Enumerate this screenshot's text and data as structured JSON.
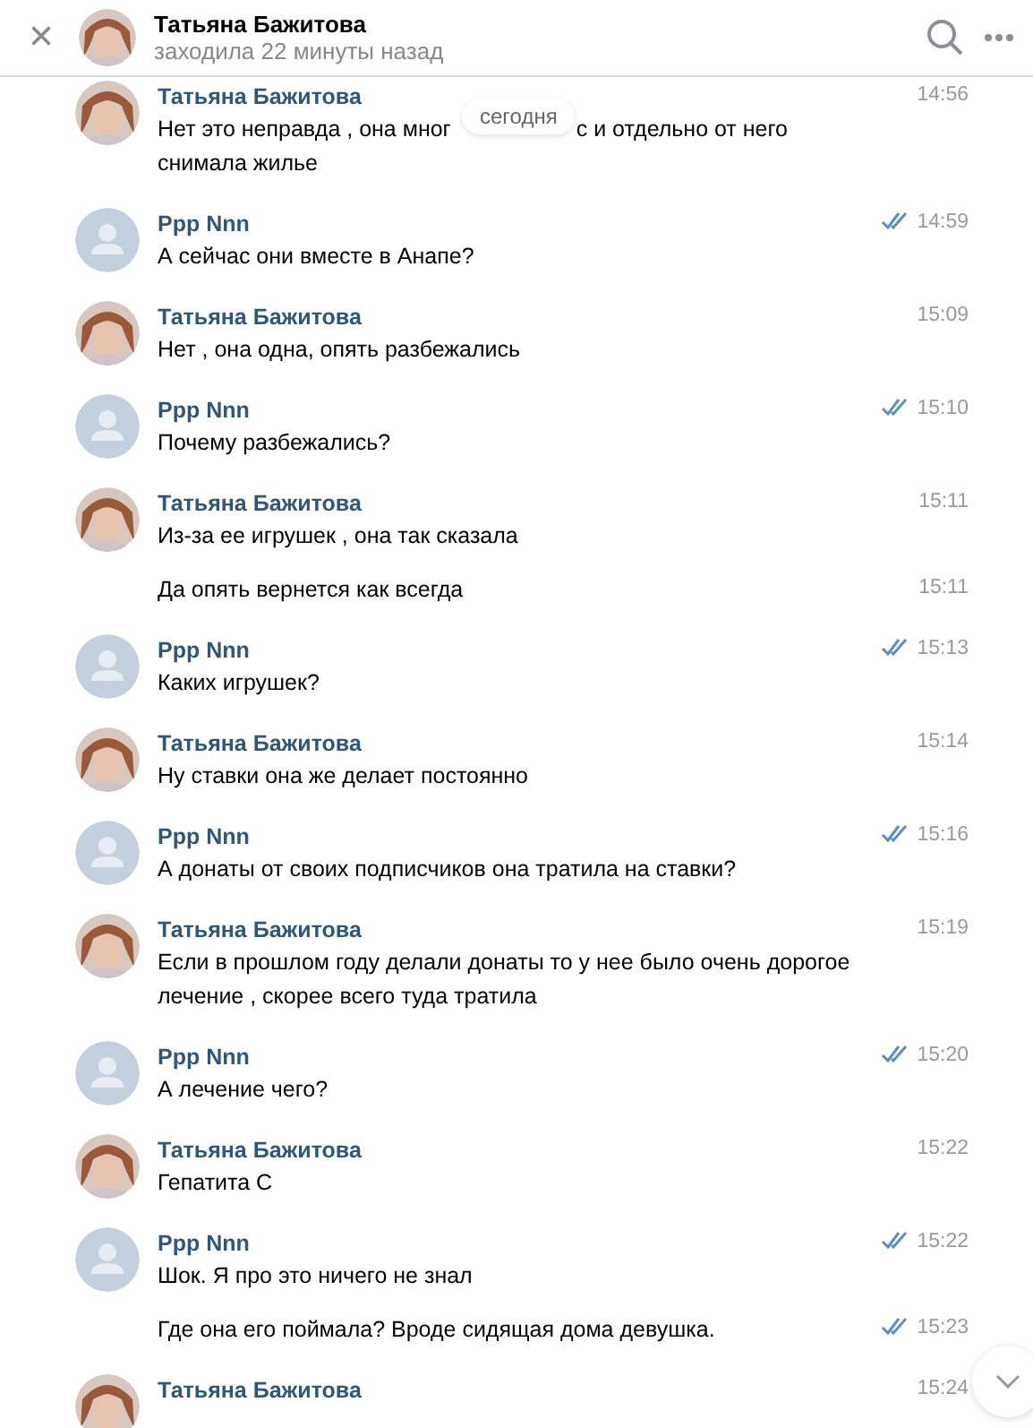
{
  "header": {
    "close": "×",
    "title": "Татьяна Бажитова",
    "status": "заходила 22 минуты назад",
    "avatar": {
      "kind": "photo"
    }
  },
  "date_pill": "сегодня",
  "messages": [
    {
      "author": "Татьяна Бажитова",
      "avatar": {
        "kind": "photo"
      },
      "lines": [
        [
          "Нет это неправда , она мног",
          "с и отдельно от него"
        ],
        [
          "снимала жилье"
        ]
      ],
      "time": "14:56",
      "read": false
    },
    {
      "author": "Ppp Nnn",
      "avatar": {
        "kind": "default"
      },
      "text": "А сейчас они вместе в Анапе?",
      "time": "14:59",
      "read": true
    },
    {
      "author": "Татьяна Бажитова",
      "avatar": {
        "kind": "photo"
      },
      "text": "Нет , она одна, опять разбежались",
      "time": "15:09",
      "read": false
    },
    {
      "author": "Ppp Nnn",
      "avatar": {
        "kind": "default"
      },
      "text": "Почему разбежались?",
      "time": "15:10",
      "read": true
    },
    {
      "author": "Татьяна Бажитова",
      "avatar": {
        "kind": "photo"
      },
      "text": "Из-за ее игрушек , она так сказала",
      "time": "15:11",
      "read": false
    },
    {
      "text": "Да опять вернется как всегда",
      "time": "15:11",
      "read": false
    },
    {
      "author": "Ppp Nnn",
      "avatar": {
        "kind": "default"
      },
      "text": "Каких игрушек?",
      "time": "15:13",
      "read": true
    },
    {
      "author": "Татьяна Бажитова",
      "avatar": {
        "kind": "photo"
      },
      "text": "Ну ставки она же делает постоянно",
      "time": "15:14",
      "read": false
    },
    {
      "author": "Ppp Nnn",
      "avatar": {
        "kind": "default"
      },
      "text": "А донаты от своих подписчиков она тратила на ставки?",
      "time": "15:16",
      "read": true
    },
    {
      "author": "Татьяна Бажитова",
      "avatar": {
        "kind": "photo"
      },
      "text": "Если в прошлом году делали донаты то у нее было очень дорогое лечение , скорее всего туда тратила",
      "time": "15:19",
      "read": false
    },
    {
      "author": "Ppp Nnn",
      "avatar": {
        "kind": "default"
      },
      "text": "А лечение чего?",
      "time": "15:20",
      "read": true
    },
    {
      "author": "Татьяна Бажитова",
      "avatar": {
        "kind": "photo"
      },
      "text": "Гепатита С",
      "time": "15:22",
      "read": false
    },
    {
      "author": "Ppp Nnn",
      "avatar": {
        "kind": "default"
      },
      "text": "Шок. Я про это ничего не знал",
      "time": "15:22",
      "read": true
    },
    {
      "text": "Где она его поймала? Вроде сидящая дома девушка.",
      "time": "15:23",
      "read": true
    },
    {
      "author": "Татьяна Бажитова",
      "avatar": {
        "kind": "photo"
      },
      "time": "15:24",
      "read": false
    }
  ]
}
